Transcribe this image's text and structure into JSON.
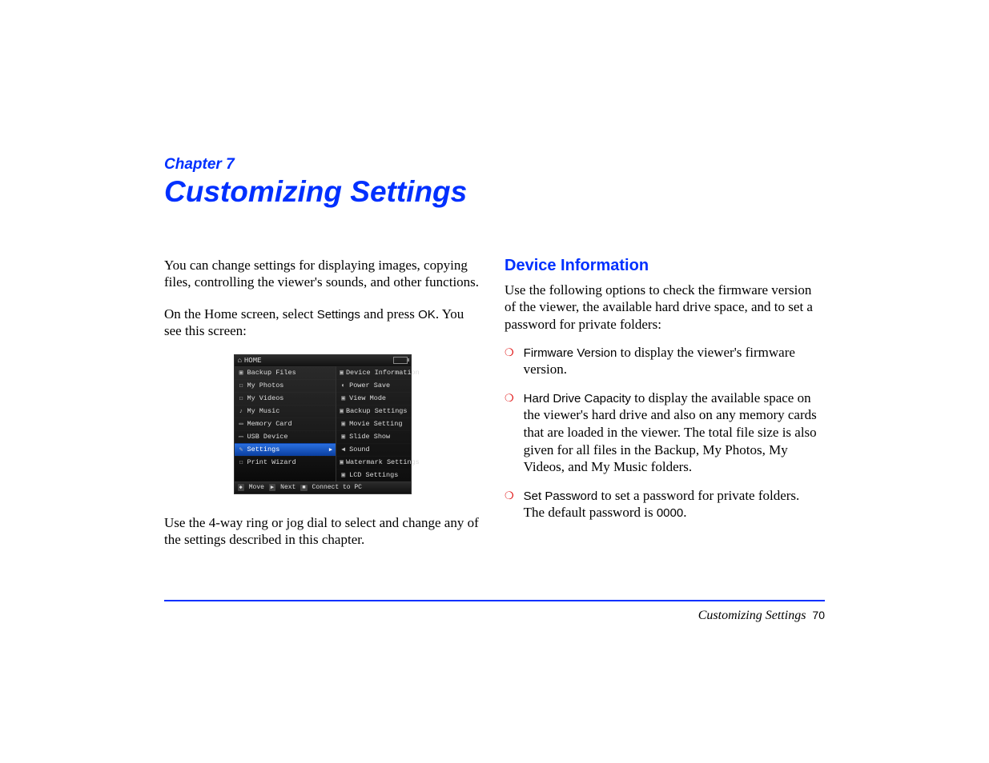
{
  "chapter_label": "Chapter 7",
  "chapter_title": "Customizing Settings",
  "left": {
    "p1": "You can change settings for displaying images, copying files, controlling the viewer's sounds, and other functions.",
    "p2_a": "On the Home screen, select ",
    "p2_b": "Settings",
    "p2_c": " and press ",
    "p2_d": "OK",
    "p2_e": ". You see this screen:",
    "p3": "Use the 4-way ring or jog dial to select and change any of the settings described in this chapter."
  },
  "device": {
    "top": "HOME",
    "left_items": [
      "Backup Files",
      "My Photos",
      "My Videos",
      "My Music",
      "Memory Card",
      "USB Device",
      "Settings",
      "Print Wizard"
    ],
    "right_items": [
      "Device Information",
      "Power Save",
      "View Mode",
      "Backup Settings",
      "Movie Setting",
      "Slide Show",
      "Sound",
      "Watermark Settings",
      "LCD Settings"
    ],
    "bottom": {
      "k1": "Move",
      "k2": "Next",
      "k3": "Connect to PC"
    }
  },
  "right": {
    "heading": "Device Information",
    "intro": "Use the following options to check the firmware version of the viewer, the available hard drive space, and to set a password for private folders:",
    "items": [
      {
        "label": "Firmware Version",
        "text": " to display the viewer's firmware version."
      },
      {
        "label": "Hard Drive Capacity",
        "text": " to display the available space on the viewer's hard drive and also on any memory cards that are loaded in the viewer. The total file size is also given for all files in the Backup, My Photos, My Videos, and My Music folders."
      },
      {
        "label": "Set Password",
        "text_a": " to set a password for private folders. The default password is ",
        "code": "0000",
        "text_b": "."
      }
    ]
  },
  "footer": {
    "title": "Customizing Settings",
    "page": "70"
  }
}
